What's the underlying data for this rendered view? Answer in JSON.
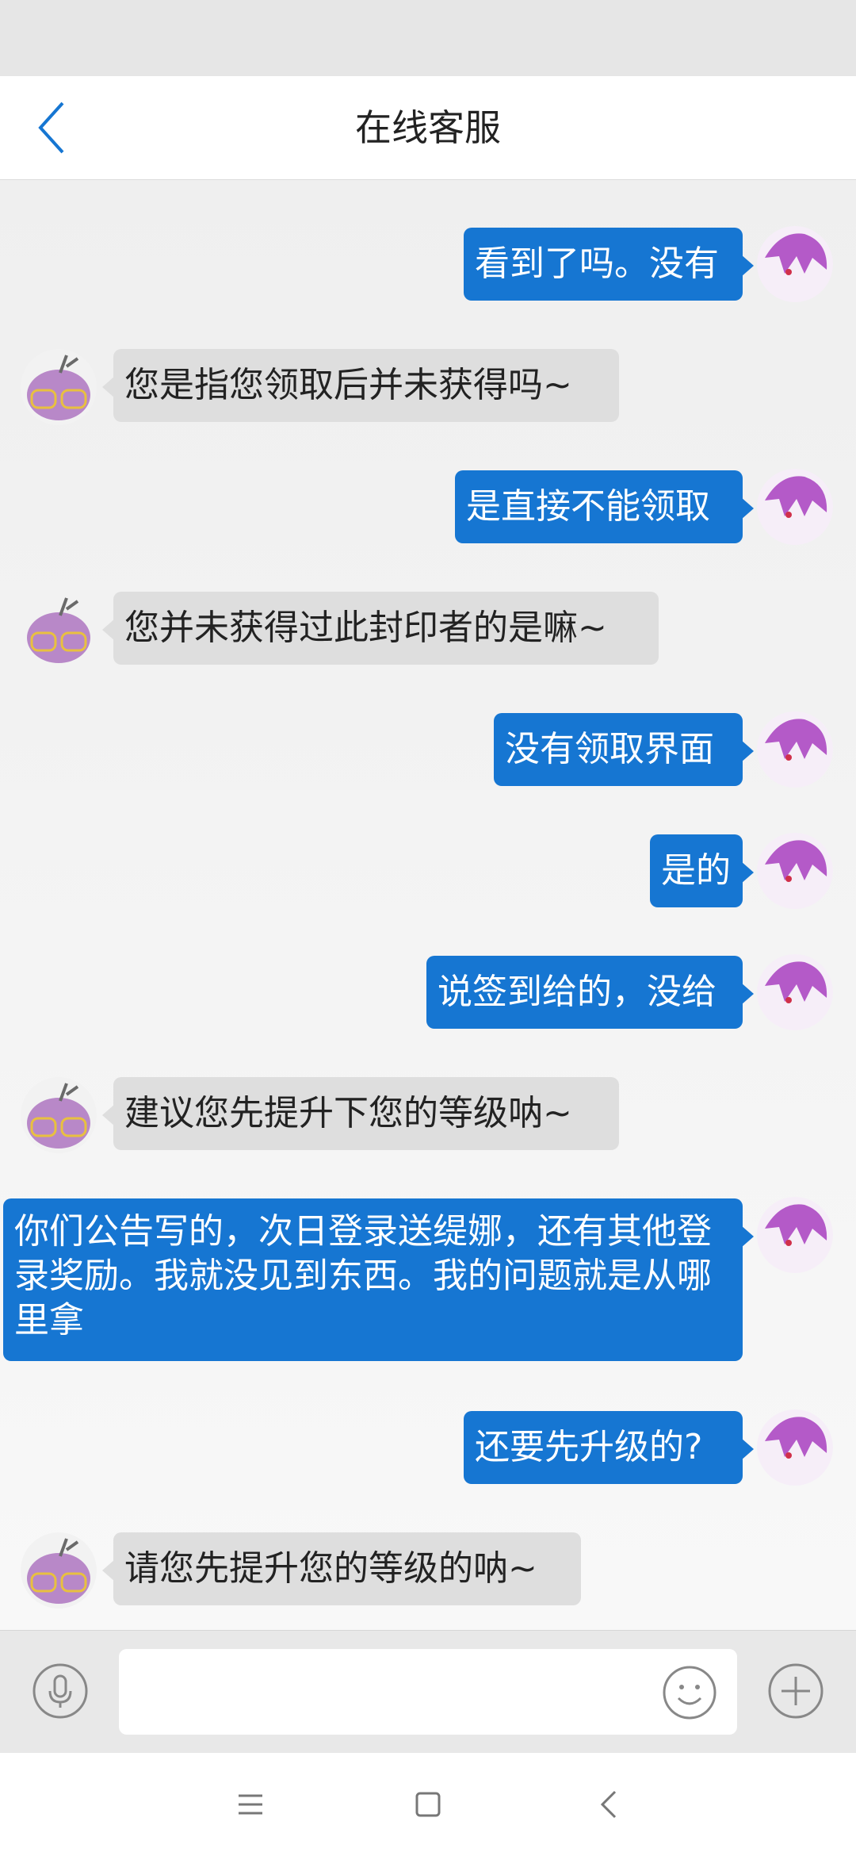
{
  "header": {
    "title": "在线客服"
  },
  "messages": [
    {
      "from": "user",
      "text": "看到了吗。没有"
    },
    {
      "from": "agent",
      "text": "您是指您领取后并未获得吗~"
    },
    {
      "from": "user",
      "text": "是直接不能领取"
    },
    {
      "from": "agent",
      "text": "您并未获得过此封印者的是嘛~"
    },
    {
      "from": "user",
      "text": "没有领取界面"
    },
    {
      "from": "user",
      "text": "是的"
    },
    {
      "from": "user",
      "text": "说签到给的，没给"
    },
    {
      "from": "agent",
      "text": "建议您先提升下您的等级呐~"
    },
    {
      "from": "user",
      "text": "你们公告写的，次日登录送缇娜，还有其他登录奖励。我就没见到东西。我的问题就是从哪里拿"
    },
    {
      "from": "user",
      "text": "还要先升级的?"
    },
    {
      "from": "agent",
      "text": "请您先提升您的等级的呐~"
    }
  ],
  "input": {
    "value": "",
    "placeholder": ""
  },
  "icons": {
    "back": "chevron-left-icon",
    "mic": "microphone-icon",
    "emoji": "smiley-icon",
    "plus": "plus-icon",
    "nav_menu": "menu-icon",
    "nav_home": "square-icon",
    "nav_back": "chevron-left-icon"
  },
  "colors": {
    "accent": "#1676d2",
    "agent_bubble": "#dedede",
    "background": "#efefef"
  }
}
